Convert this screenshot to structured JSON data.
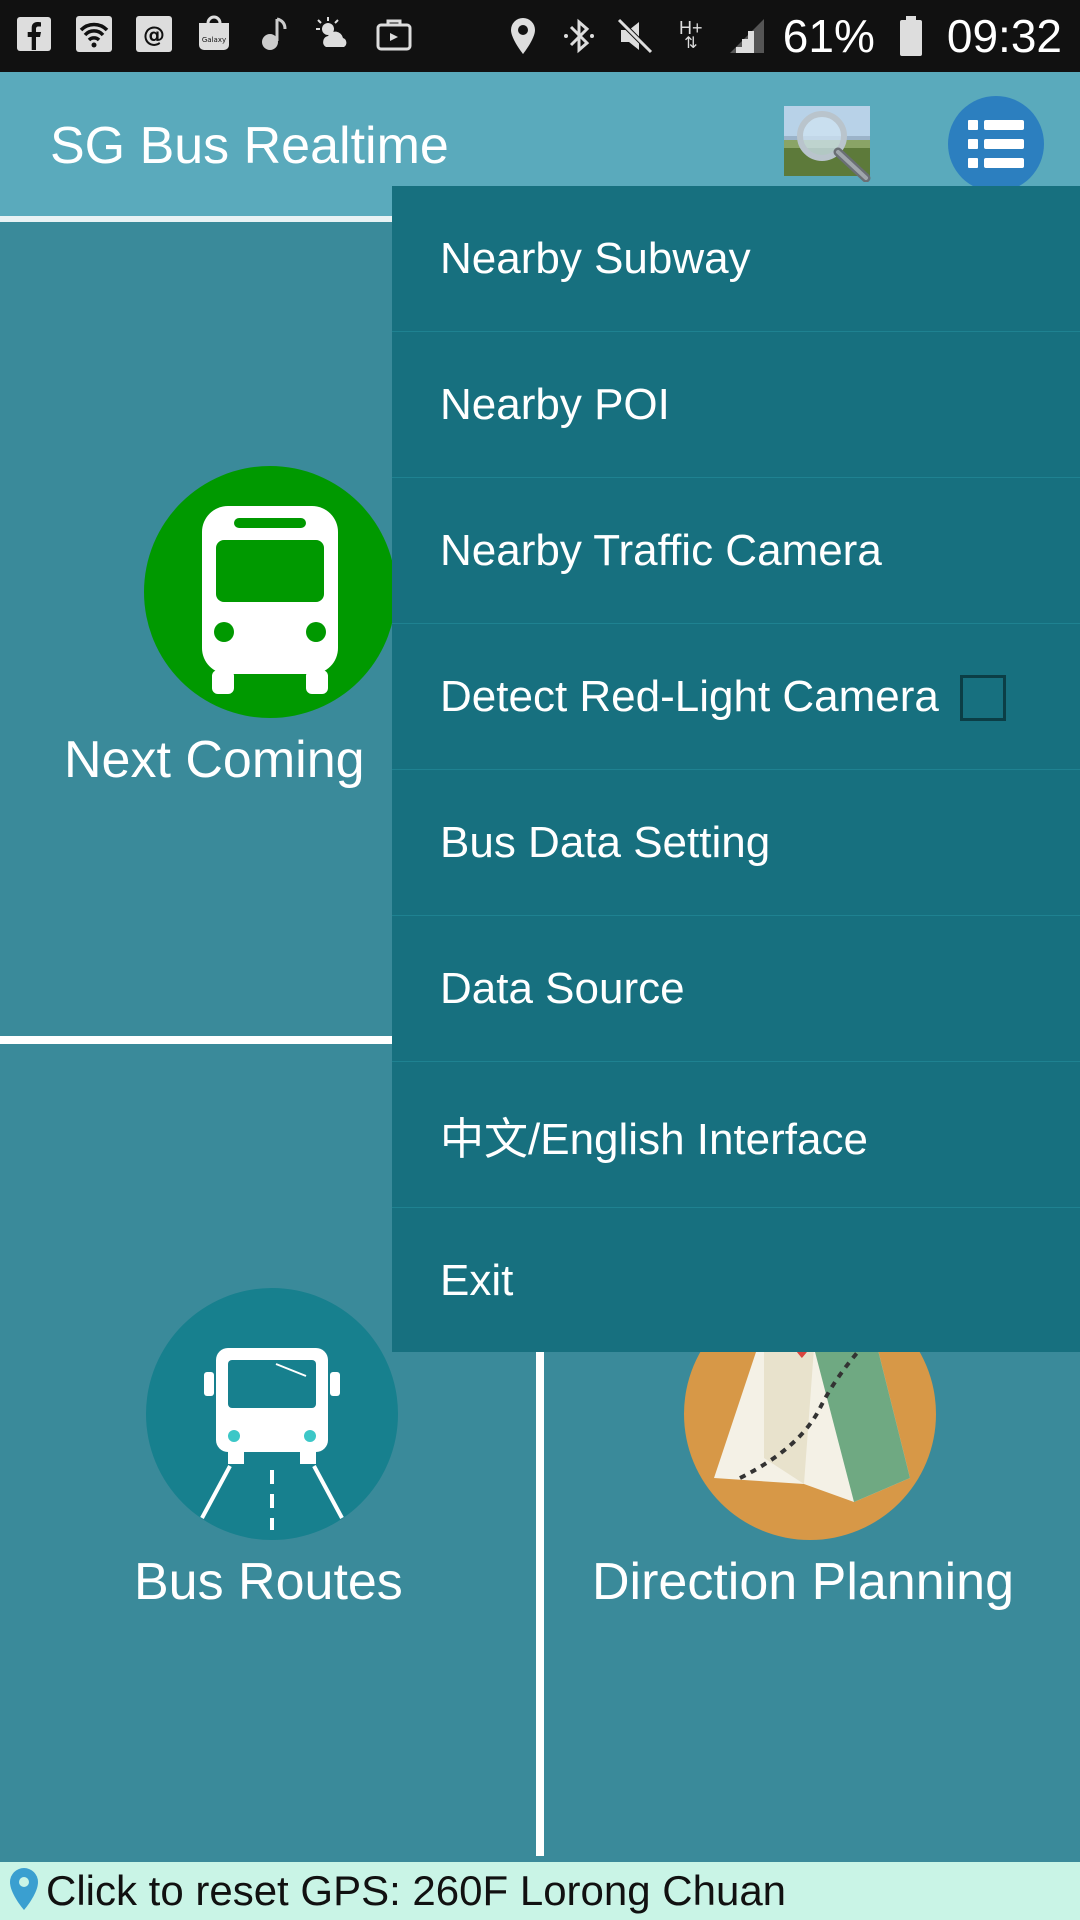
{
  "status_bar": {
    "battery": "61%",
    "time": "09:32",
    "network": "H+"
  },
  "app_bar": {
    "title": "SG Bus Realtime"
  },
  "tiles": {
    "next_coming": "Next Coming",
    "bus_routes": "Bus Routes",
    "direction_planning": "Direction Planning"
  },
  "menu": {
    "items": [
      {
        "label": "Nearby Subway"
      },
      {
        "label": "Nearby POI"
      },
      {
        "label": "Nearby Traffic Camera"
      },
      {
        "label": "Detect Red-Light Camera",
        "checked": false
      },
      {
        "label": "Bus Data Setting"
      },
      {
        "label": "Data Source"
      },
      {
        "label": "中文/English Interface"
      },
      {
        "label": "Exit"
      }
    ]
  },
  "gps_bar": {
    "text": "Click to reset GPS: 260F Lorong Chuan"
  },
  "colors": {
    "status_bar": "#111111",
    "app_bar": "#5aaabc",
    "tile_bg": "#3a8a9a",
    "menu_bg": "#17707f",
    "bus_circle": "#009900",
    "routes_circle": "#17808e",
    "map_circle": "#d79847",
    "gps_bar": "#c9f4e6"
  },
  "icons": {
    "status_left": [
      "facebook-icon",
      "wifi-icon",
      "email-icon",
      "galaxy-apps-icon",
      "music-icon",
      "weather-icon",
      "briefcase-icon"
    ],
    "status_right": [
      "location-icon",
      "bluetooth-icon",
      "mute-icon",
      "signal-icon",
      "battery-icon"
    ],
    "app_bar": [
      "search-magnifier-icon",
      "list-menu-icon"
    ],
    "tiles": [
      "bus-front-icon",
      "bus-road-icon",
      "map-pin-icon"
    ],
    "gps": "location-pin-icon"
  }
}
